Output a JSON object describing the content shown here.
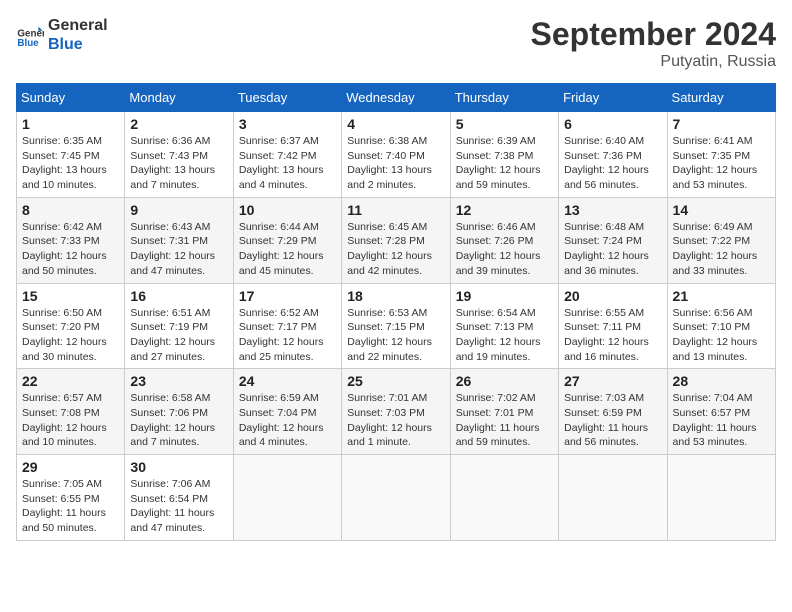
{
  "header": {
    "logo_line1": "General",
    "logo_line2": "Blue",
    "month_title": "September 2024",
    "location": "Putyatin, Russia"
  },
  "weekdays": [
    "Sunday",
    "Monday",
    "Tuesday",
    "Wednesday",
    "Thursday",
    "Friday",
    "Saturday"
  ],
  "weeks": [
    [
      {
        "day": "1",
        "info": "Sunrise: 6:35 AM\nSunset: 7:45 PM\nDaylight: 13 hours and 10 minutes."
      },
      {
        "day": "2",
        "info": "Sunrise: 6:36 AM\nSunset: 7:43 PM\nDaylight: 13 hours and 7 minutes."
      },
      {
        "day": "3",
        "info": "Sunrise: 6:37 AM\nSunset: 7:42 PM\nDaylight: 13 hours and 4 minutes."
      },
      {
        "day": "4",
        "info": "Sunrise: 6:38 AM\nSunset: 7:40 PM\nDaylight: 13 hours and 2 minutes."
      },
      {
        "day": "5",
        "info": "Sunrise: 6:39 AM\nSunset: 7:38 PM\nDaylight: 12 hours and 59 minutes."
      },
      {
        "day": "6",
        "info": "Sunrise: 6:40 AM\nSunset: 7:36 PM\nDaylight: 12 hours and 56 minutes."
      },
      {
        "day": "7",
        "info": "Sunrise: 6:41 AM\nSunset: 7:35 PM\nDaylight: 12 hours and 53 minutes."
      }
    ],
    [
      {
        "day": "8",
        "info": "Sunrise: 6:42 AM\nSunset: 7:33 PM\nDaylight: 12 hours and 50 minutes."
      },
      {
        "day": "9",
        "info": "Sunrise: 6:43 AM\nSunset: 7:31 PM\nDaylight: 12 hours and 47 minutes."
      },
      {
        "day": "10",
        "info": "Sunrise: 6:44 AM\nSunset: 7:29 PM\nDaylight: 12 hours and 45 minutes."
      },
      {
        "day": "11",
        "info": "Sunrise: 6:45 AM\nSunset: 7:28 PM\nDaylight: 12 hours and 42 minutes."
      },
      {
        "day": "12",
        "info": "Sunrise: 6:46 AM\nSunset: 7:26 PM\nDaylight: 12 hours and 39 minutes."
      },
      {
        "day": "13",
        "info": "Sunrise: 6:48 AM\nSunset: 7:24 PM\nDaylight: 12 hours and 36 minutes."
      },
      {
        "day": "14",
        "info": "Sunrise: 6:49 AM\nSunset: 7:22 PM\nDaylight: 12 hours and 33 minutes."
      }
    ],
    [
      {
        "day": "15",
        "info": "Sunrise: 6:50 AM\nSunset: 7:20 PM\nDaylight: 12 hours and 30 minutes."
      },
      {
        "day": "16",
        "info": "Sunrise: 6:51 AM\nSunset: 7:19 PM\nDaylight: 12 hours and 27 minutes."
      },
      {
        "day": "17",
        "info": "Sunrise: 6:52 AM\nSunset: 7:17 PM\nDaylight: 12 hours and 25 minutes."
      },
      {
        "day": "18",
        "info": "Sunrise: 6:53 AM\nSunset: 7:15 PM\nDaylight: 12 hours and 22 minutes."
      },
      {
        "day": "19",
        "info": "Sunrise: 6:54 AM\nSunset: 7:13 PM\nDaylight: 12 hours and 19 minutes."
      },
      {
        "day": "20",
        "info": "Sunrise: 6:55 AM\nSunset: 7:11 PM\nDaylight: 12 hours and 16 minutes."
      },
      {
        "day": "21",
        "info": "Sunrise: 6:56 AM\nSunset: 7:10 PM\nDaylight: 12 hours and 13 minutes."
      }
    ],
    [
      {
        "day": "22",
        "info": "Sunrise: 6:57 AM\nSunset: 7:08 PM\nDaylight: 12 hours and 10 minutes."
      },
      {
        "day": "23",
        "info": "Sunrise: 6:58 AM\nSunset: 7:06 PM\nDaylight: 12 hours and 7 minutes."
      },
      {
        "day": "24",
        "info": "Sunrise: 6:59 AM\nSunset: 7:04 PM\nDaylight: 12 hours and 4 minutes."
      },
      {
        "day": "25",
        "info": "Sunrise: 7:01 AM\nSunset: 7:03 PM\nDaylight: 12 hours and 1 minute."
      },
      {
        "day": "26",
        "info": "Sunrise: 7:02 AM\nSunset: 7:01 PM\nDaylight: 11 hours and 59 minutes."
      },
      {
        "day": "27",
        "info": "Sunrise: 7:03 AM\nSunset: 6:59 PM\nDaylight: 11 hours and 56 minutes."
      },
      {
        "day": "28",
        "info": "Sunrise: 7:04 AM\nSunset: 6:57 PM\nDaylight: 11 hours and 53 minutes."
      }
    ],
    [
      {
        "day": "29",
        "info": "Sunrise: 7:05 AM\nSunset: 6:55 PM\nDaylight: 11 hours and 50 minutes."
      },
      {
        "day": "30",
        "info": "Sunrise: 7:06 AM\nSunset: 6:54 PM\nDaylight: 11 hours and 47 minutes."
      },
      {
        "day": "",
        "info": ""
      },
      {
        "day": "",
        "info": ""
      },
      {
        "day": "",
        "info": ""
      },
      {
        "day": "",
        "info": ""
      },
      {
        "day": "",
        "info": ""
      }
    ]
  ]
}
